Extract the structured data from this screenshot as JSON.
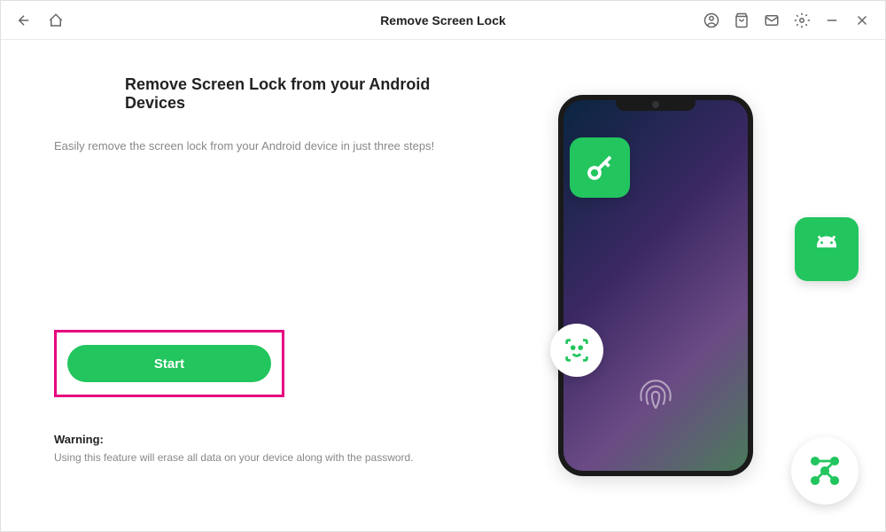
{
  "titlebar": {
    "title": "Remove Screen Lock"
  },
  "main": {
    "heading": "Remove Screen Lock from your Android Devices",
    "description": "Easily remove the screen lock from your Android device in just three steps!",
    "start_label": "Start",
    "warning_title": "Warning:",
    "warning_text": "Using this feature will erase all data on your device along with the password."
  }
}
